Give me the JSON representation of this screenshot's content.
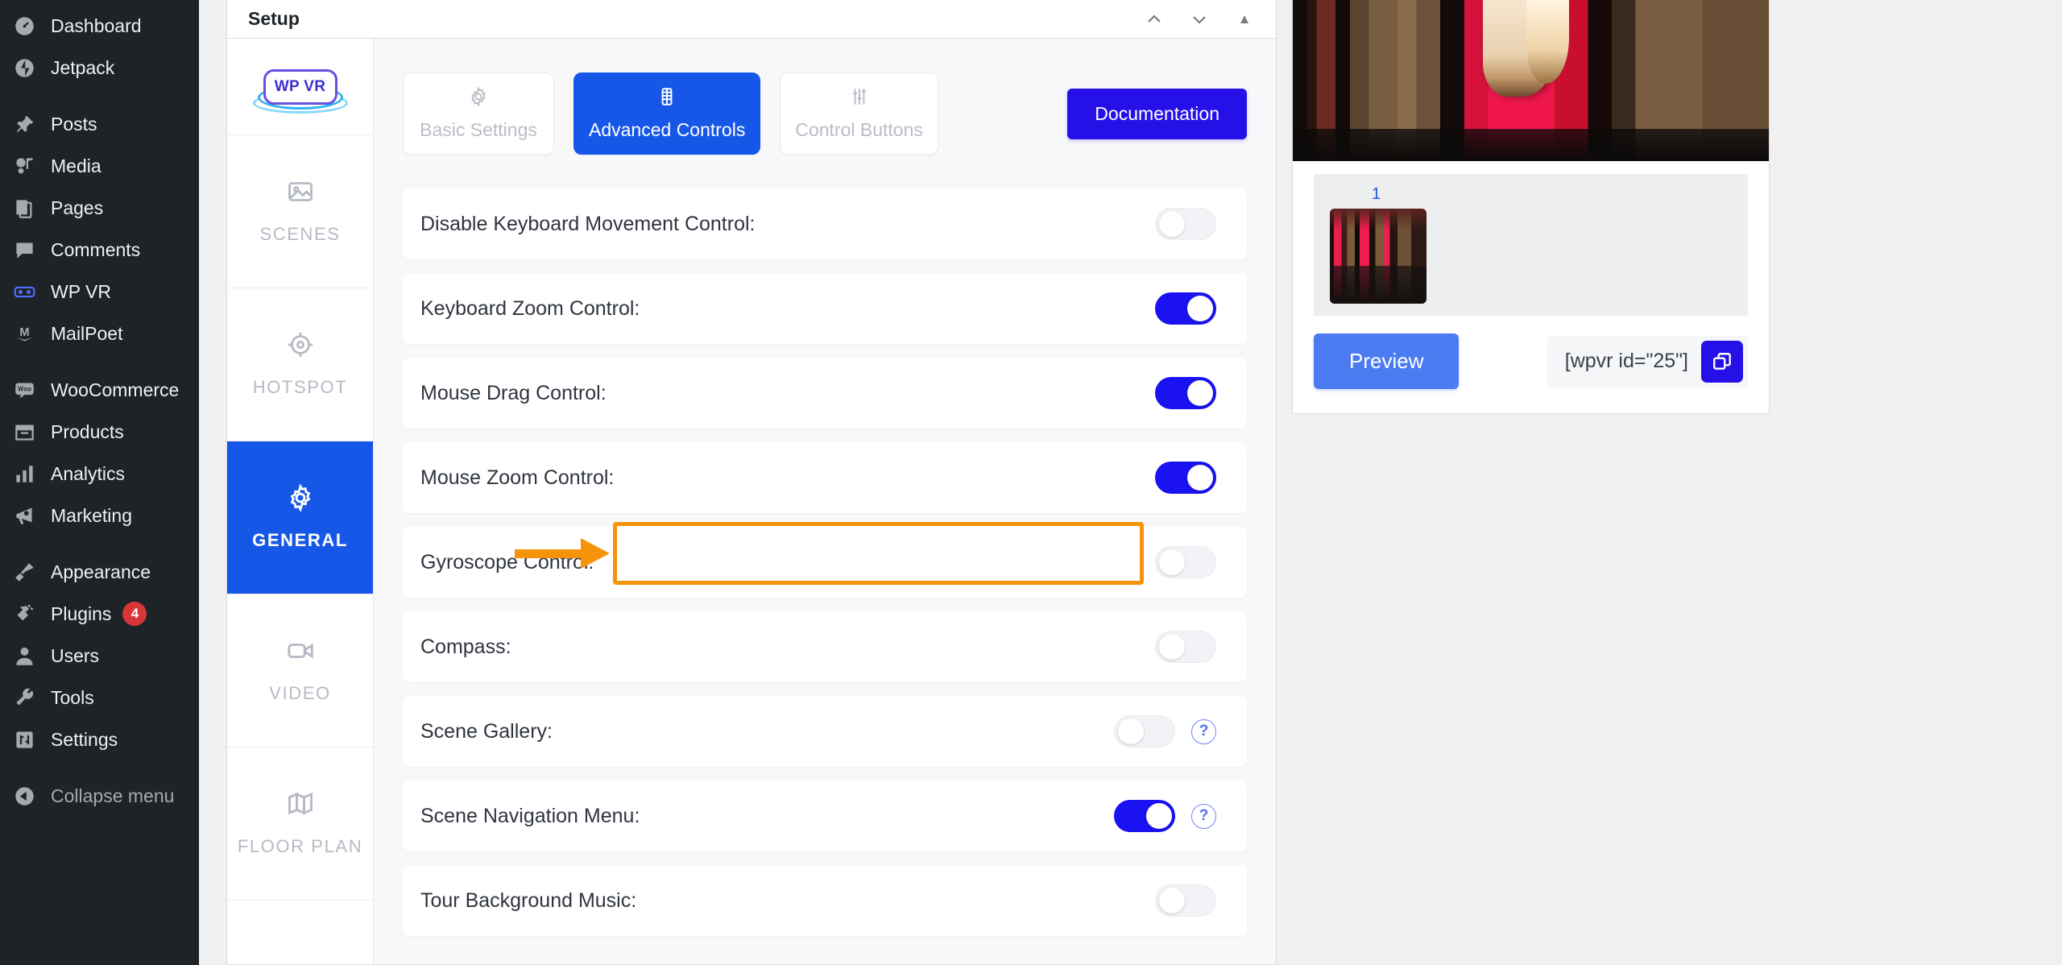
{
  "sidebar": {
    "items": [
      {
        "label": "Dashboard",
        "icon": "dashboard-icon",
        "group": 0
      },
      {
        "label": "Jetpack",
        "icon": "jetpack-icon",
        "group": 0
      },
      {
        "label": "Posts",
        "icon": "pin-icon",
        "group": 1
      },
      {
        "label": "Media",
        "icon": "media-icon",
        "group": 1
      },
      {
        "label": "Pages",
        "icon": "pages-icon",
        "group": 1
      },
      {
        "label": "Comments",
        "icon": "comments-icon",
        "group": 1
      },
      {
        "label": "WP VR",
        "icon": "vr-goggles-icon",
        "group": 1
      },
      {
        "label": "MailPoet",
        "icon": "mailpoet-icon",
        "group": 1
      },
      {
        "label": "WooCommerce",
        "icon": "woocommerce-icon",
        "group": 2
      },
      {
        "label": "Products",
        "icon": "products-icon",
        "group": 2
      },
      {
        "label": "Analytics",
        "icon": "analytics-icon",
        "group": 2
      },
      {
        "label": "Marketing",
        "icon": "marketing-icon",
        "group": 2
      },
      {
        "label": "Appearance",
        "icon": "appearance-brush-icon",
        "group": 3
      },
      {
        "label": "Plugins",
        "icon": "plugins-plug-icon",
        "badge": "4",
        "group": 3
      },
      {
        "label": "Users",
        "icon": "users-icon",
        "group": 3
      },
      {
        "label": "Tools",
        "icon": "tools-wrench-icon",
        "group": 3
      },
      {
        "label": "Settings",
        "icon": "settings-sliders-icon",
        "group": 3
      },
      {
        "label": "Collapse menu",
        "icon": "collapse-arrow-icon",
        "group": 4
      }
    ]
  },
  "metabox": {
    "title": "Setup",
    "actions": [
      {
        "name": "move-up-button",
        "icon": "chevron-up-icon"
      },
      {
        "name": "move-down-button",
        "icon": "chevron-down-icon"
      },
      {
        "name": "toggle-panel-button",
        "icon": "triangle-up-icon"
      }
    ]
  },
  "rail": {
    "logo_text": "WP VR",
    "items": [
      {
        "label": "SCENES",
        "icon": "image-icon",
        "active": false
      },
      {
        "label": "HOTSPOT",
        "icon": "hotspot-target-icon",
        "active": false
      },
      {
        "label": "GENERAL",
        "icon": "gear-icon",
        "active": true
      },
      {
        "label": "VIDEO",
        "icon": "video-camera-icon",
        "active": false
      },
      {
        "label": "FLOOR PLAN",
        "icon": "map-icon",
        "active": false
      }
    ]
  },
  "tabs": [
    {
      "label": "Basic Settings",
      "icon": "gear-icon",
      "active": false
    },
    {
      "label": "Advanced Controls",
      "icon": "panel-icon",
      "active": true
    },
    {
      "label": "Control Buttons",
      "icon": "sliders-icon",
      "active": false
    }
  ],
  "documentation_button": "Documentation",
  "settings_rows": [
    {
      "label": "Disable Keyboard Movement Control:",
      "on": false,
      "info": false
    },
    {
      "label": "Keyboard Zoom Control:",
      "on": true,
      "info": false
    },
    {
      "label": "Mouse Drag Control:",
      "on": true,
      "info": false
    },
    {
      "label": "Mouse Zoom Control:",
      "on": true,
      "info": false
    },
    {
      "label": "Gyroscope Control:",
      "on": false,
      "info": false
    },
    {
      "label": "Compass:",
      "on": false,
      "info": false
    },
    {
      "label": "Scene Gallery:",
      "on": false,
      "info": true
    },
    {
      "label": "Scene Navigation Menu:",
      "on": true,
      "info": true,
      "highlighted": true
    },
    {
      "label": "Tour Background Music:",
      "on": false,
      "info": false
    }
  ],
  "preview": {
    "thumbnail_number": "1",
    "preview_button": "Preview",
    "shortcode": "[wpvr id=\"25\"]",
    "copy_icon": "copy-icon"
  },
  "colors": {
    "accent_blue": "#1757e8",
    "toggle_on": "#1a12f0",
    "doc_button": "#2610e8",
    "highlight_orange": "#f5940b",
    "preview_button": "#4b7bf0",
    "badge_red": "#d63638",
    "sidebar_bg": "#1d2327"
  },
  "info_symbol": "?"
}
